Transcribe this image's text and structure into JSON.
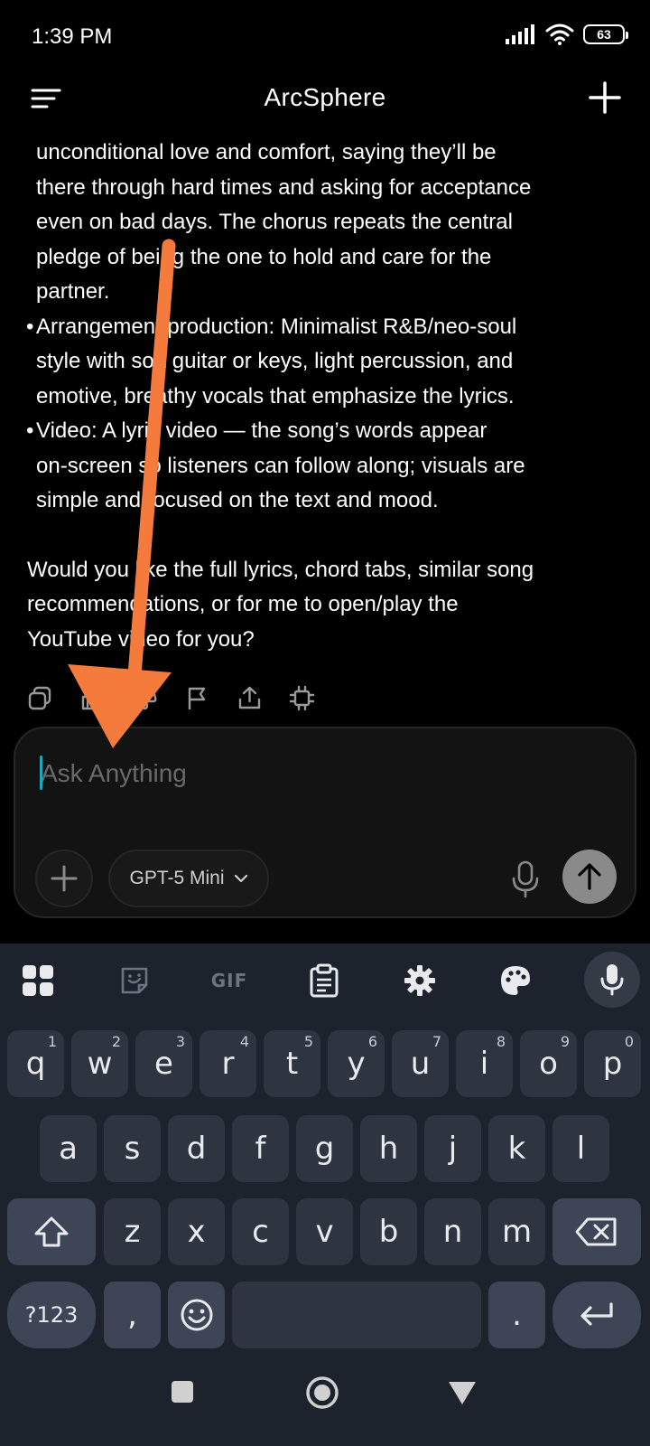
{
  "status": {
    "time": "1:39 PM",
    "battery": "63"
  },
  "header": {
    "title": "ArcSphere"
  },
  "message": {
    "lines_intro": [
      "unconditional love and comfort, saying they’ll be",
      "there through hard times and asking for acceptance",
      "even on bad days. The chorus repeats the central",
      "pledge of being the one to hold and care for the",
      "partner."
    ],
    "bullet_arrangement": [
      "Arrangement/production: Minimalist R&B/neo-soul",
      "style with soft guitar or keys, light percussion, and",
      "emotive, breathy vocals that emphasize the lyrics."
    ],
    "bullet_video": [
      "Video: A lyric video — the song’s words appear",
      "on-screen so listeners can follow along; visuals are",
      "simple and focused on the text and mood."
    ],
    "closing": [
      "Would you like the full lyrics, chord tabs, similar song",
      "recommendations, or for me to open/play the",
      "YouTube video for you?"
    ]
  },
  "composer": {
    "placeholder": "Ask Anything",
    "model_label": "GPT-5 Mini"
  },
  "keyboard": {
    "row1": [
      {
        "k": "q",
        "h": "1"
      },
      {
        "k": "w",
        "h": "2"
      },
      {
        "k": "e",
        "h": "3"
      },
      {
        "k": "r",
        "h": "4"
      },
      {
        "k": "t",
        "h": "5"
      },
      {
        "k": "y",
        "h": "6"
      },
      {
        "k": "u",
        "h": "7"
      },
      {
        "k": "i",
        "h": "8"
      },
      {
        "k": "o",
        "h": "9"
      },
      {
        "k": "p",
        "h": "0"
      }
    ],
    "row2": [
      "a",
      "s",
      "d",
      "f",
      "g",
      "h",
      "j",
      "k",
      "l"
    ],
    "row3": [
      "z",
      "x",
      "c",
      "v",
      "b",
      "n",
      "m"
    ],
    "symbols_label": "?123",
    "comma": ",",
    "period": ".",
    "gif_label": "GIF"
  },
  "colors": {
    "arrow": "#f47b3b",
    "cursor": "#1ea9bd",
    "keyboard_bg": "#1d232d",
    "key_bg": "#2e3440",
    "special_key_bg": "#3d4556"
  }
}
